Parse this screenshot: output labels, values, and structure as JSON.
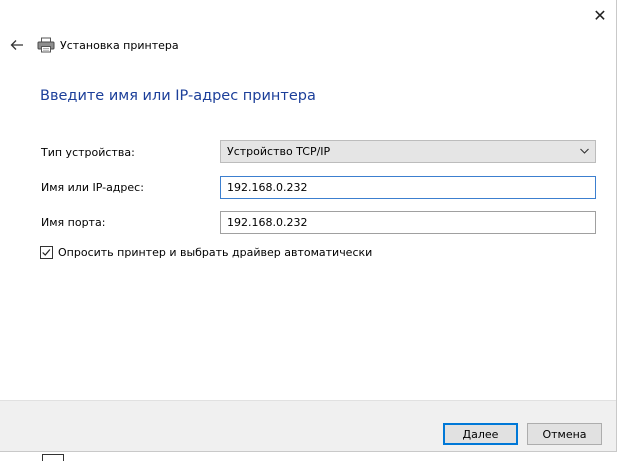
{
  "window": {
    "title": "Установка принтера",
    "close_glyph": "✕"
  },
  "icons": {
    "back": "back-arrow-icon",
    "printer": "printer-icon",
    "dropdown": "chevron-down-icon",
    "check": "checkmark-icon"
  },
  "colors": {
    "heading": "#1c3f9a",
    "focus_border": "#3c7fcf",
    "default_button_border": "#0078d7",
    "footer_bg": "#f0f0f0"
  },
  "main": {
    "heading": "Введите имя или IP-адрес принтера",
    "device_type": {
      "label": "Тип устройства:",
      "selected": "Устройство TCP/IP"
    },
    "host": {
      "label": "Имя или IP-адрес:",
      "value": "192.168.0.232"
    },
    "port": {
      "label": "Имя порта:",
      "value": "192.168.0.232"
    },
    "auto_driver": {
      "label": "Опросить принтер и выбрать драйвер автоматически",
      "checked": true
    }
  },
  "footer": {
    "next_label": "Далее",
    "cancel_label": "Отмена"
  }
}
